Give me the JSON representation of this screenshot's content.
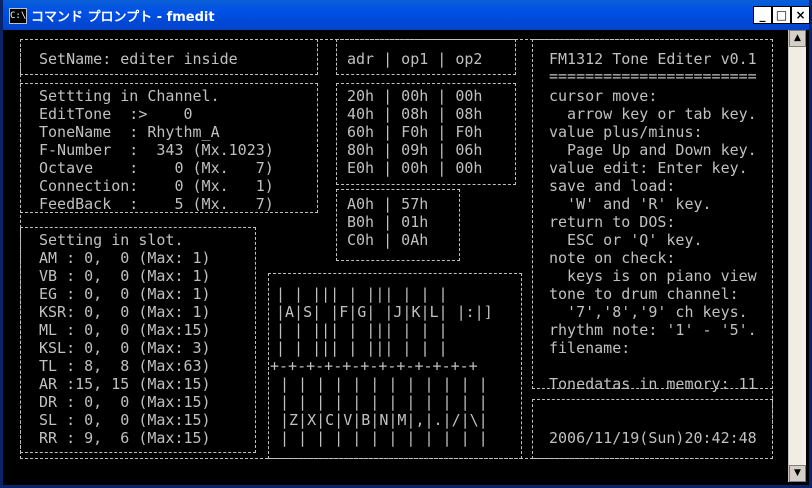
{
  "window": {
    "icon_text": "C:\\",
    "title": "コマンド プロンプト - fmedit",
    "min": "_",
    "max": "□",
    "close": "×"
  },
  "header": {
    "setname": "SetName: editer inside"
  },
  "channel": {
    "title": "Settting in Channel.",
    "lines": [
      "EditTone  :>    0",
      "ToneName  : Rhythm_A",
      "F-Number  :  343 (Mx.1023)",
      "Octave    :    0 (Mx.   7)",
      "Connection:    0 (Mx.   1)",
      "FeedBack  :    5 (Mx.   7)"
    ]
  },
  "slot": {
    "title": "Setting in slot.",
    "lines": [
      "AM : 0,  0 (Max: 1)",
      "VB : 0,  0 (Max: 1)",
      "EG : 0,  0 (Max: 1)",
      "KSR: 0,  0 (Max: 1)",
      "ML : 0,  0 (Max:15)",
      "KSL: 0,  0 (Max: 3)",
      "TL : 8,  8 (Max:63)",
      "AR :15, 15 (Max:15)",
      "DR : 0,  0 (Max:15)",
      "SL : 0,  0 (Max:15)",
      "RR : 9,  6 (Max:15)"
    ]
  },
  "regs": {
    "head": "adr | op1 | op2",
    "rows": [
      "20h | 00h | 00h",
      "40h | 08h | 08h",
      "60h | F0h | F0h",
      "80h | 09h | 06h",
      "E0h | 00h | 00h"
    ],
    "rows2": [
      "A0h | 57h",
      "B0h | 01h",
      "C0h | 0Ah"
    ]
  },
  "piano": {
    "top_rows": [
      "| | ||| | ||| | | |",
      "|A|S| |F|G| |J|K|L| |:|]",
      "| | ||| | ||| | | |",
      "| | ||| | ||| | | |"
    ],
    "sep": "+-+-+-+-+-+-+-+-+-+-+-+",
    "bot_rows": [
      "| | | | | | | | | | | |",
      "| | | | | | | | | | | |",
      "|Z|X|C|V|B|N|M|,|.|/|\\|",
      "| | | | | | | | | | | |"
    ]
  },
  "help": {
    "title": "FM1312 Tone Editer v0.1",
    "rule": "=======================",
    "lines": [
      "cursor move:",
      "  arrow key or tab key.",
      "value plus/minus:",
      "  Page Up and Down key.",
      "value edit: Enter key.",
      "save and load:",
      "  'W' and 'R' key.",
      "return to DOS:",
      "  ESC or 'Q' key.",
      "note on check:",
      "  keys is on piano view",
      "tone to drum channel:",
      "  '7','8','9' ch keys.",
      "rhythm note: '1' - '5'.",
      "filename:"
    ],
    "memory": "Tonedatas in memory: 11",
    "datetime": "2006/11/19(Sun)20:42:48"
  }
}
